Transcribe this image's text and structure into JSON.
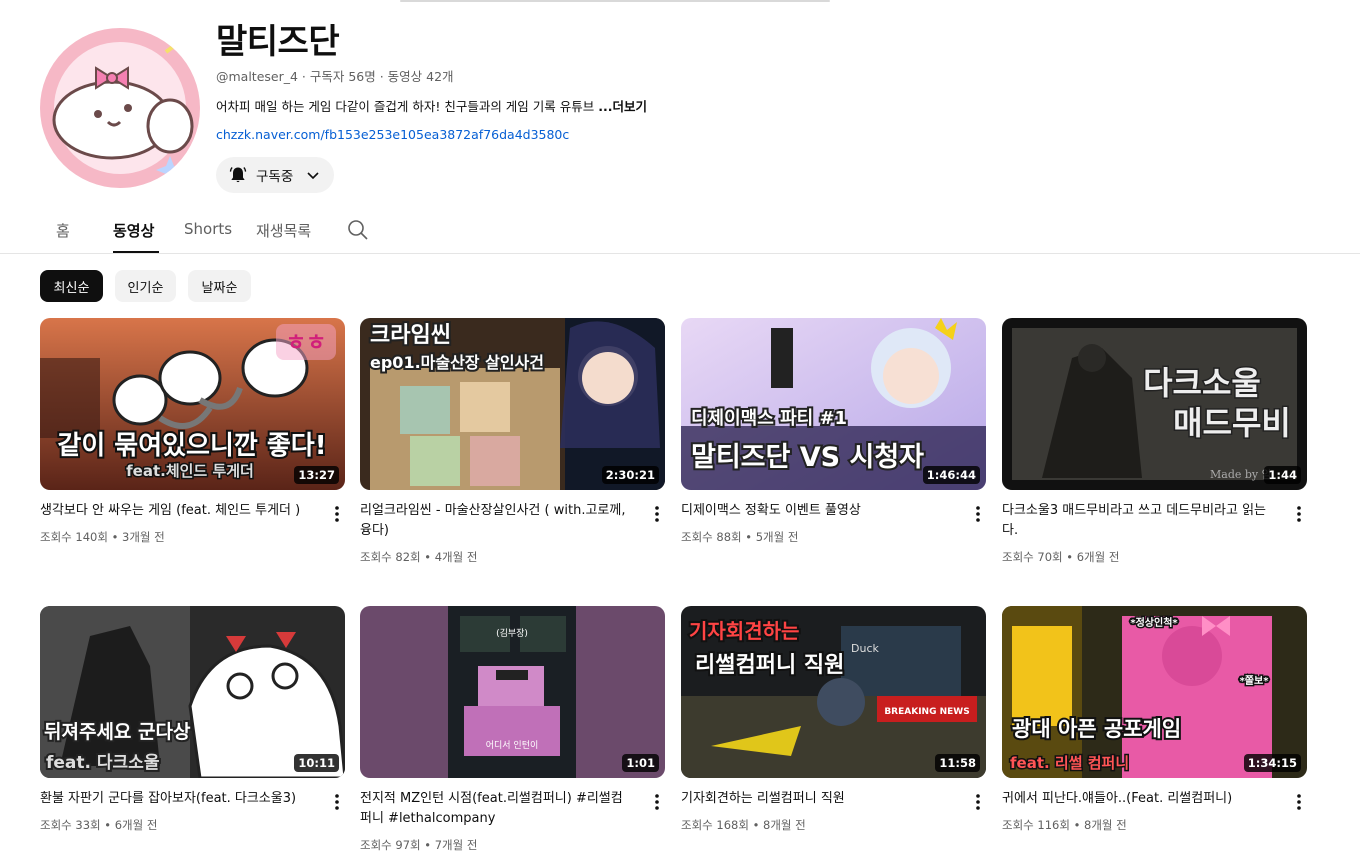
{
  "channel": {
    "name": "말티즈단",
    "meta": "@malteser_4 · 구독자 56명 · 동영상 42개",
    "description": "어차피 매일 하는 게임 다같이 즐겁게 하자! 친구들과의  게임 기록 유튜브 ",
    "more_label": "...더보기",
    "link": "chzzk.naver.com/fb153e253e105ea3872af76da4d3580c",
    "subscribe_label": "구독중"
  },
  "tabs": [
    {
      "label": "홈"
    },
    {
      "label": "동영상"
    },
    {
      "label": "Shorts"
    },
    {
      "label": "재생목록"
    }
  ],
  "chips": [
    {
      "label": "최신순",
      "active": true
    },
    {
      "label": "인기순",
      "active": false
    },
    {
      "label": "날짜순",
      "active": false
    }
  ],
  "videos": [
    {
      "title": "생각보다 안 싸우는 게임 (feat. 체인드 투게더 )",
      "meta": "조회수 140회 • 3개월 전",
      "duration": "13:27",
      "thumb_text": [
        "같이 묶여있으니깐 좋다!",
        "feat.체인드 투게더",
        "ㅎㅎ"
      ]
    },
    {
      "title": "리얼크라임씬 - 마술산장살인사건 ( with.고로께, 융다)",
      "meta": "조회수 82회 • 4개월 전",
      "duration": "2:30:21",
      "thumb_text": [
        "크라임씬",
        "ep01.마술산장 살인사건"
      ]
    },
    {
      "title": "디제이맥스 정확도 이벤트 풀영상",
      "meta": "조회수 88회 • 5개월 전",
      "duration": "1:46:44",
      "thumb_text": [
        "디제이맥스 파티 #1",
        "말티즈단 VS 시청자"
      ]
    },
    {
      "title": "다크소울3 매드무비라고 쓰고 데드무비라고 읽는다.",
      "meta": "조회수 70회 • 6개월 전",
      "duration": "1:44",
      "thumb_text": [
        "다크소울",
        "매드무비",
        "Made by 암"
      ]
    },
    {
      "title": "환불 자판기 군다를 잡아보자(feat. 다크소울3)",
      "meta": "조회수 33회 • 6개월 전",
      "duration": "10:11",
      "thumb_text": [
        "뒤져주세요 군다상",
        "feat. 다크소울"
      ]
    },
    {
      "title": "전지적 MZ인턴 시점(feat.리썰컴퍼니) #리썰컴퍼니 #lethalcompany",
      "meta": "조회수 97회 • 7개월 전",
      "duration": "1:01",
      "thumb_text": [
        "(김부장)",
        "어디서 인턴이"
      ]
    },
    {
      "title": "기자회견하는 리썰컴퍼니 직원",
      "meta": "조회수 168회 • 8개월 전",
      "duration": "11:58",
      "thumb_text": [
        "기자회견하는",
        "리썰컴퍼니 직원",
        "BREAKING NEWS",
        "Duck"
      ]
    },
    {
      "title": "귀에서 피난다.얘들아..(Feat. 리썰컴퍼니)",
      "meta": "조회수 116회 • 8개월 전",
      "duration": "1:34:15",
      "thumb_text": [
        "광대 아픈 공포게임",
        "feat. 리썰 컴퍼니",
        "*정상인척*",
        "*쫄보*"
      ]
    }
  ],
  "icons": {
    "bell": "bell-icon",
    "chevron": "chevron-down-icon",
    "search": "search-icon",
    "more": "more-vert-icon"
  },
  "colors": {
    "link": "#065fd4",
    "chip_active_bg": "#0f0f0f",
    "chip_bg": "#f2f2f2",
    "meta_text": "#606060"
  }
}
